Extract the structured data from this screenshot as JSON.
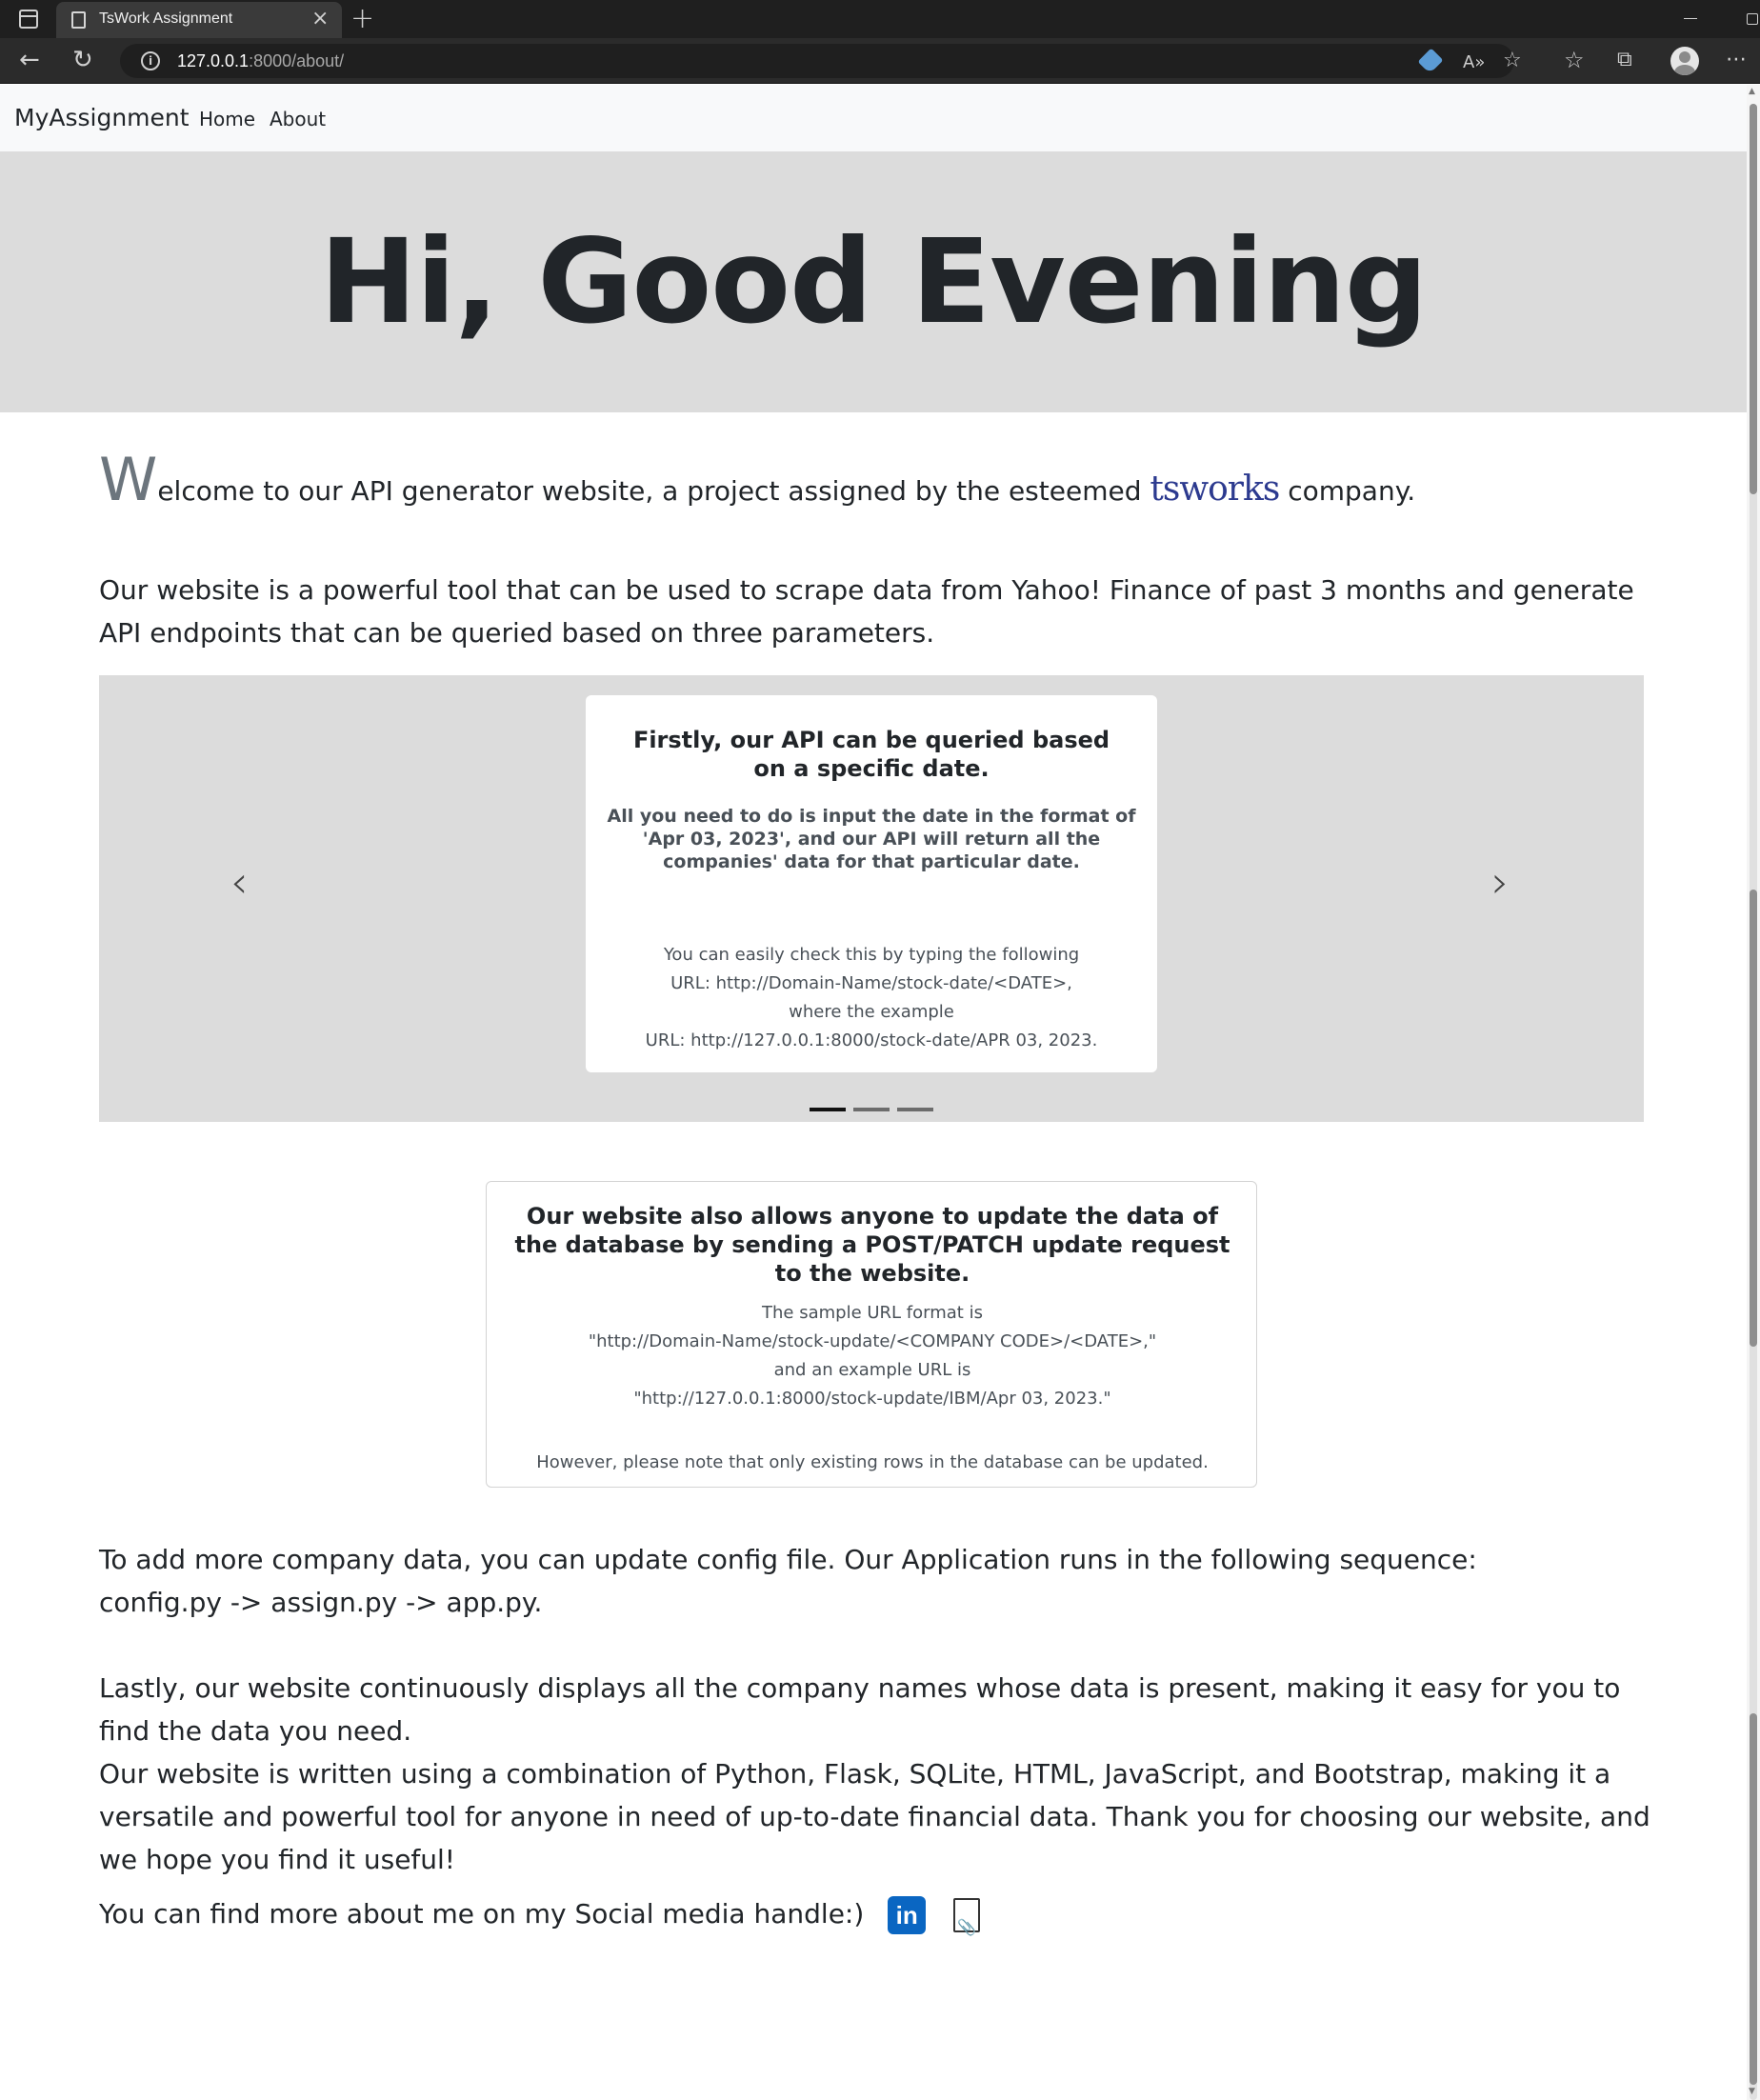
{
  "browser": {
    "tab_title": "TsWork Assignment",
    "url_host": "127.0.0.1",
    "url_path": ":8000/about/"
  },
  "navbar": {
    "brand": "MyAssignment",
    "links": [
      "Home",
      "About"
    ]
  },
  "hero": {
    "greeting": "Hi, Good Evening"
  },
  "intro": {
    "dropcap": "W",
    "text_before_logo": "elcome to our API generator website, a project assigned by the esteemed",
    "logo_text": "tsworks",
    "text_after_logo": "company."
  },
  "paragraph_tool": "Our website is a powerful tool that can be used to scrape data from Yahoo! Finance of past 3 months and generate API endpoints that can be queried based on three parameters.",
  "carousel": {
    "title": "Firstly, our API can be queried based on a specific date.",
    "lead": "All you need to do is input the date in the format of 'Apr 03, 2023', and our API will return all the companies' data for that particular date.",
    "body_lines": [
      "You can easily check this by typing the following",
      "URL: http://Domain-Name/stock-date/<DATE>,",
      "where the example",
      "URL: http://127.0.0.1:8000/stock-date/APR 03, 2023."
    ],
    "prev_glyph": "‹",
    "next_glyph": "›",
    "slide_count": 3,
    "active_slide": 1
  },
  "update_card": {
    "title": "Our website also allows anyone to update the data of the database by sending a POST/PATCH update request to the website.",
    "body_lines": [
      "The sample URL format is",
      "\"http://Domain-Name/stock-update/<COMPANY CODE>/<DATE>,\"",
      "and an example URL is",
      "\"http://127.0.0.1:8000/stock-update/IBM/Apr 03, 2023.\""
    ],
    "note": "However, please note that only existing rows in the database can be updated."
  },
  "paragraph_config_1": "To add more company data, you can update config file. Our Application runs in the following sequence:",
  "paragraph_config_2": "config.py -> assign.py -> app.py.",
  "paragraph_lastly": "Lastly, our website continuously displays all the company names whose data is present, making it easy for you to find the data you need.",
  "paragraph_tech": "Our website is written using a combination of Python, Flask, SQLite, HTML, JavaScript, and Bootstrap, making it a versatile and powerful tool for anyone in need of up-to-date financial data. Thank you for choosing our website, and we hope you find it useful!",
  "social": {
    "text": "You can find more about me on my Social media handle:)",
    "linkedin_label": "in",
    "icons": [
      "linkedin-icon",
      "document-icon"
    ],
    "colors": {
      "linkedin": "#0a66c2"
    }
  },
  "colors": {
    "hero_bg": "#dcdcdc",
    "navbar_bg": "#f8f9fa",
    "text": "#212529",
    "tsworks_logo": "#2c3a8f"
  }
}
